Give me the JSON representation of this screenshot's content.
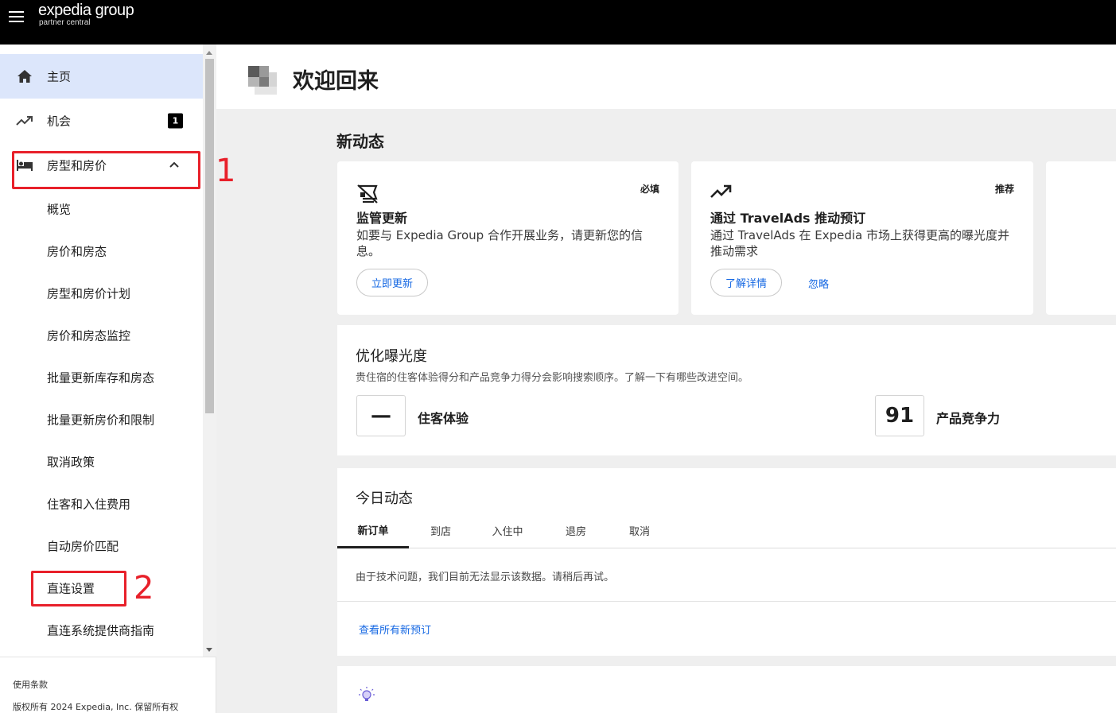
{
  "topbar": {
    "brand": "expedia group",
    "brand_sub": "partner central"
  },
  "sidebar": {
    "items": [
      {
        "label": "主页"
      },
      {
        "label": "机会",
        "badge": "1"
      },
      {
        "label": "房型和房价"
      }
    ],
    "subitems": [
      "概览",
      "房价和房态",
      "房型和房价计划",
      "房价和房态监控",
      "批量更新库存和房态",
      "批量更新房价和限制",
      "取消政策",
      "住客和入住费用",
      "自动房价匹配",
      "直连设置",
      "直连系统提供商指南"
    ],
    "footer": {
      "terms": "使用条款",
      "copyright": "版权所有 2024 Expedia, Inc. 保留所有权"
    }
  },
  "annotations": {
    "one": "1",
    "two": "2",
    "color": "#e8202a"
  },
  "header": {
    "title": "欢迎回来"
  },
  "news": {
    "title": "新动态",
    "cards": [
      {
        "tag": "必填",
        "title": "监管更新",
        "desc": "如要与 Expedia Group 合作开展业务，请更新您的信息。",
        "button": "立即更新"
      },
      {
        "tag": "推荐",
        "title": "通过 TravelAds 推动预订",
        "desc": "通过 TravelAds 在 Expedia 市场上获得更高的曝光度并推动需求",
        "button": "了解详情",
        "link": "忽略"
      }
    ]
  },
  "visibility": {
    "title": "优化曝光度",
    "subtitle": "贵住宿的住客体验得分和产品竞争力得分会影响搜索顺序。了解一下有哪些改进空间。",
    "guest_score": "—",
    "guest_label": "住客体验",
    "product_score": "91",
    "product_label": "产品竞争力"
  },
  "today": {
    "title": "今日动态",
    "tabs": [
      "新订单",
      "到店",
      "入住中",
      "退房",
      "取消"
    ],
    "message": "由于技术问题，我们目前无法显示该数据。请稍后再试。",
    "link": "查看所有新预订"
  },
  "colors": {
    "accent": "#1668e3",
    "active_nav": "#dce6fb",
    "topbar": "#000000"
  },
  "icons": [
    "menu-icon",
    "home-icon",
    "trending-icon",
    "bed-icon",
    "chevron-up-icon",
    "regulatory-icon",
    "lightbulb-icon"
  ]
}
